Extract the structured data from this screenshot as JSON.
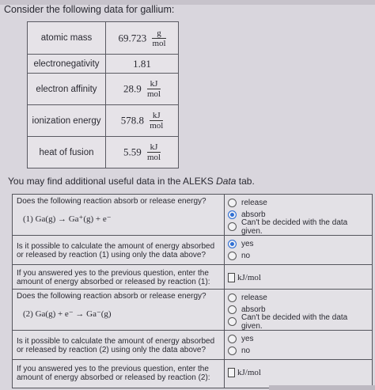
{
  "title": "Consider the following data for gallium:",
  "data_table": [
    {
      "label": "atomic mass",
      "value": "69.723",
      "unit_num": "g",
      "unit_den": "mol"
    },
    {
      "label": "electronegativity",
      "value": "1.81",
      "unit_num": "",
      "unit_den": ""
    },
    {
      "label": "electron affinity",
      "value": "28.9",
      "unit_num": "kJ",
      "unit_den": "mol"
    },
    {
      "label": "ionization energy",
      "value": "578.8",
      "unit_num": "kJ",
      "unit_den": "mol"
    },
    {
      "label": "heat of fusion",
      "value": "5.59",
      "unit_num": "kJ",
      "unit_den": "mol"
    }
  ],
  "note_prefix": "You may find additional useful data in the ALEKS ",
  "note_italic": "Data",
  "note_suffix": " tab.",
  "q1": {
    "question": "Does the following reaction absorb or release energy?",
    "reaction": "(1)   Ga(g)  →  Ga⁺(g) + e⁻",
    "options": [
      "release",
      "absorb",
      "Can't be decided with the data given."
    ],
    "selected": 1
  },
  "q2": {
    "question": "Is it possible to calculate the amount of energy absorbed or released by reaction (1) using only the data above?",
    "options": [
      "yes",
      "no"
    ],
    "selected": 0
  },
  "q3": {
    "question": "If you answered yes to the previous question, enter the amount of energy absorbed or released by reaction (1):",
    "unit": "kJ/mol",
    "value": ""
  },
  "q4": {
    "question": "Does the following reaction absorb or release energy?",
    "reaction": "(2)   Ga(g) + e⁻  →  Ga⁻(g)",
    "options": [
      "release",
      "absorb",
      "Can't be decided with the data given."
    ],
    "selected": -1
  },
  "q5": {
    "question": "Is it possible to calculate the amount of energy absorbed or released by reaction (2) using only the data above?",
    "options": [
      "yes",
      "no"
    ],
    "selected": -1
  },
  "q6": {
    "question": "If you answered yes to the previous question, enter the amount of energy absorbed or released by reaction (2):",
    "unit": "kJ/mol",
    "value": ""
  }
}
